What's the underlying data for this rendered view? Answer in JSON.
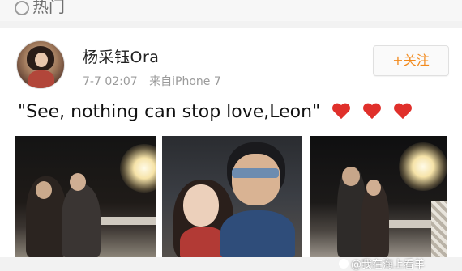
{
  "top": {
    "tag_label": "热门"
  },
  "post": {
    "username": "杨采钰Ora",
    "time": "7-7 02:07",
    "source": "来自iPhone 7",
    "follow_label": "+关注",
    "text": "\"See, nothing can stop love,Leon\"",
    "hearts": [
      "red-heart-emoji",
      "red-heart-emoji",
      "red-heart-emoji"
    ],
    "photos": [
      "photo-1",
      "photo-2",
      "photo-3"
    ]
  },
  "watermark": {
    "text": "@我在海上看羊"
  },
  "colors": {
    "follow": "#f28a1d",
    "heart": "#e0302b"
  }
}
